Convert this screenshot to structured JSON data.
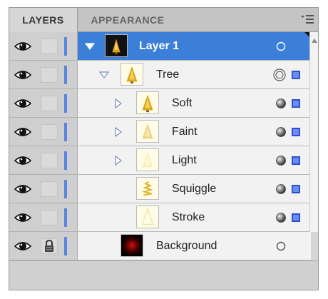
{
  "tabs": {
    "layers": "LAYERS",
    "appearance": "APPEARANCE"
  },
  "layers": [
    {
      "name": "Layer 1",
      "selected": true,
      "expanded": true,
      "has_arrow": true,
      "thumb": "layer-thumb",
      "visible": true,
      "locked": false,
      "target": "hollow"
    },
    {
      "name": "Tree",
      "selected": false,
      "expanded": true,
      "has_arrow": true,
      "thumb": "tree-thumb",
      "visible": true,
      "locked": false,
      "target": "double-ring"
    },
    {
      "name": "Soft",
      "selected": false,
      "expanded": false,
      "has_arrow": true,
      "thumb": "tree-thumb",
      "visible": true,
      "locked": false,
      "target": "filled"
    },
    {
      "name": "Faint",
      "selected": false,
      "expanded": false,
      "has_arrow": true,
      "thumb": "faint-thumb",
      "visible": true,
      "locked": false,
      "target": "filled"
    },
    {
      "name": "Light",
      "selected": false,
      "expanded": false,
      "has_arrow": true,
      "thumb": "light-thumb",
      "visible": true,
      "locked": false,
      "target": "filled"
    },
    {
      "name": "Squiggle",
      "selected": false,
      "expanded": false,
      "has_arrow": false,
      "thumb": "squiggle-thumb",
      "visible": true,
      "locked": false,
      "target": "filled"
    },
    {
      "name": "Stroke",
      "selected": false,
      "expanded": false,
      "has_arrow": false,
      "thumb": "stroke-thumb",
      "visible": true,
      "locked": false,
      "target": "filled"
    },
    {
      "name": "Background",
      "selected": false,
      "expanded": false,
      "has_arrow": false,
      "thumb": "background-thumb",
      "visible": true,
      "locked": true,
      "target": "hollow"
    }
  ],
  "colors": {
    "selection": "#3b7fd8",
    "layer_color_bar": "#5a86e0",
    "selection_square": "#2f4fd0"
  },
  "icons": {
    "panel_menu": "panel-menu-icon",
    "visibility": "eye-icon",
    "lock": "lock-icon",
    "expand": "disclosure-triangle-icon",
    "target": "target-circle-icon",
    "selection": "selection-square-icon"
  }
}
